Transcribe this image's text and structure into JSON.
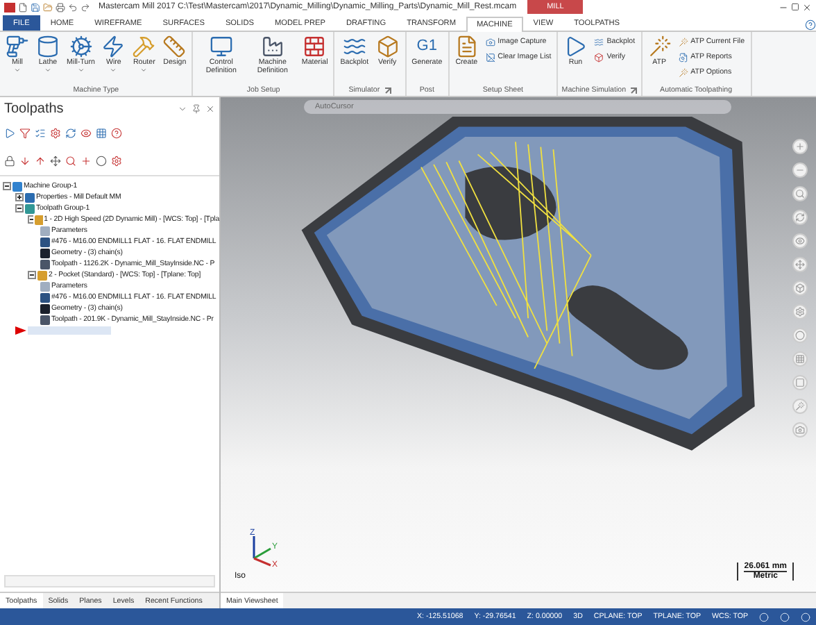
{
  "title_bar": {
    "title": "Mastercam Mill 2017  C:\\Test\\Mastercam\\2017\\Dynamic_Milling\\Dynamic_Milling_Parts\\Dynamic_Mill_Rest.mcam",
    "context_tab": "MILL"
  },
  "ribbon": {
    "tabs": [
      {
        "label": "FILE",
        "selected": false,
        "kind": "file"
      },
      {
        "label": "HOME",
        "selected": false
      },
      {
        "label": "WIREFRAME",
        "selected": false
      },
      {
        "label": "SURFACES",
        "selected": false
      },
      {
        "label": "SOLIDS",
        "selected": false
      },
      {
        "label": "MODEL PREP",
        "selected": false
      },
      {
        "label": "DRAFTING",
        "selected": false
      },
      {
        "label": "TRANSFORM",
        "selected": false
      },
      {
        "label": "MACHINE",
        "selected": true
      },
      {
        "label": "VIEW",
        "selected": false
      },
      {
        "label": "TOOLPATHS",
        "selected": false
      }
    ],
    "groups": [
      {
        "name": "Machine Type",
        "launcher": false,
        "buttons": [
          {
            "label": "Mill",
            "kind": "large",
            "dropdown": true
          },
          {
            "label": "Lathe",
            "kind": "large",
            "dropdown": true
          },
          {
            "label": "Mill-Turn",
            "kind": "large",
            "dropdown": true
          },
          {
            "label": "Wire",
            "kind": "large",
            "dropdown": true
          },
          {
            "label": "Router",
            "kind": "large",
            "dropdown": true
          },
          {
            "label": "Design",
            "kind": "large",
            "dropdown": false
          }
        ]
      },
      {
        "name": "Job Setup",
        "launcher": false,
        "buttons": [
          {
            "label": "Control Definition",
            "kind": "large",
            "dropdown": false
          },
          {
            "label": "Machine Definition",
            "kind": "large",
            "dropdown": false
          },
          {
            "label": "Material",
            "kind": "large",
            "dropdown": false
          }
        ]
      },
      {
        "name": "Simulator",
        "launcher": true,
        "buttons": [
          {
            "label": "Backplot",
            "kind": "large",
            "dropdown": false
          },
          {
            "label": "Verify",
            "kind": "large",
            "dropdown": false
          }
        ]
      },
      {
        "name": "Post",
        "launcher": false,
        "buttons": [
          {
            "label": "Generate",
            "kind": "large",
            "dropdown": false,
            "glyph": "G1"
          }
        ]
      },
      {
        "name": "Setup Sheet",
        "launcher": false,
        "buttons": [
          {
            "label": "Create",
            "kind": "large",
            "dropdown": false
          },
          {
            "label": "Image Capture",
            "kind": "small",
            "dropdown": false
          },
          {
            "label": "Clear Image List",
            "kind": "small",
            "dropdown": false
          }
        ]
      },
      {
        "name": "Machine Simulation",
        "launcher": true,
        "buttons": [
          {
            "label": "Run",
            "kind": "large",
            "dropdown": false
          },
          {
            "label": "Backplot",
            "kind": "small",
            "dropdown": false
          },
          {
            "label": "Verify",
            "kind": "small",
            "dropdown": false
          }
        ]
      },
      {
        "name": "Automatic Toolpathing",
        "launcher": false,
        "buttons": [
          {
            "label": "ATP",
            "kind": "large",
            "dropdown": false
          },
          {
            "label": "ATP Current File",
            "kind": "small",
            "dropdown": false
          },
          {
            "label": "ATP Reports",
            "kind": "small",
            "dropdown": false
          },
          {
            "label": "ATP Options",
            "kind": "small",
            "dropdown": false
          }
        ]
      }
    ]
  },
  "panel": {
    "title": "Toolpaths",
    "tree": [
      {
        "label": "Machine Group-1",
        "kind": "machine-group",
        "expanded": true,
        "children": [
          {
            "label": "Properties - Mill Default MM",
            "kind": "properties",
            "expanded": false
          },
          {
            "label": "Toolpath Group-1",
            "kind": "toolpath-group",
            "expanded": true,
            "children": [
              {
                "label": "1 - 2D High Speed (2D Dynamic Mill) - [WCS: Top] - [Tpla",
                "kind": "operation",
                "expanded": true,
                "children": [
                  {
                    "label": "Parameters",
                    "kind": "parameters"
                  },
                  {
                    "label": "#476 - M16.00 ENDMILL1 FLAT - 16. FLAT ENDMILL",
                    "kind": "tool"
                  },
                  {
                    "label": "Geometry - (3) chain(s)",
                    "kind": "geometry"
                  },
                  {
                    "label": "Toolpath - 1126.2K - Dynamic_Mill_StayInside.NC - P",
                    "kind": "toolpath"
                  }
                ]
              },
              {
                "label": "2 - Pocket (Standard) - [WCS: Top] - [Tplane: Top]",
                "kind": "operation",
                "expanded": true,
                "children": [
                  {
                    "label": "Parameters",
                    "kind": "parameters"
                  },
                  {
                    "label": "#476 - M16.00 ENDMILL1 FLAT - 16. FLAT ENDMILL",
                    "kind": "tool"
                  },
                  {
                    "label": "Geometry - (3) chain(s)",
                    "kind": "geometry"
                  },
                  {
                    "label": "Toolpath - 201.9K - Dynamic_Mill_StayInside.NC - Pr",
                    "kind": "toolpath"
                  }
                ]
              }
            ]
          },
          {
            "kind": "insert-marker"
          }
        ]
      }
    ],
    "tabs": [
      {
        "label": "Toolpaths",
        "selected": true
      },
      {
        "label": "Solids",
        "selected": false
      },
      {
        "label": "Planes",
        "selected": false
      },
      {
        "label": "Levels",
        "selected": false
      },
      {
        "label": "Recent Functions",
        "selected": false
      }
    ]
  },
  "viewport": {
    "toolbar_label": "AutoCursor",
    "view_label": "Iso",
    "scale": "26.061 mm",
    "units": "Metric",
    "axes": [
      "Z",
      "Y",
      "X"
    ],
    "sheet_tabs": [
      {
        "label": "Main Viewsheet",
        "selected": true
      }
    ]
  },
  "status_bar": {
    "items": [
      "X:  -125.51068",
      "Y:  -29.76541",
      "Z:  0.00000",
      "3D",
      "CPLANE: TOP",
      "TPLANE: TOP",
      "WCS: TOP"
    ]
  }
}
